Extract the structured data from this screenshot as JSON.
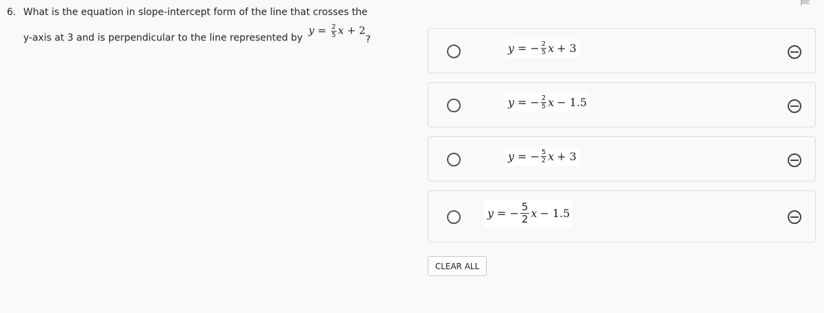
{
  "question": {
    "number": "6.",
    "line1": "What is the equation in slope-intercept form of the line that crosses the",
    "line2": "y-axis at 3 and is perpendicular to the line represented by",
    "inline_equation": {
      "lhs": "y",
      "eq": "=",
      "frac_num": "2",
      "frac_den": "5",
      "var": "x",
      "rest": "+ 2"
    },
    "qmark": "?"
  },
  "choices": [
    {
      "lhs": "y",
      "eq": "=",
      "sign": "−",
      "frac_num": "2",
      "frac_den": "5",
      "var": "x",
      "rest": "+ 3"
    },
    {
      "lhs": "y",
      "eq": "=",
      "sign": "−",
      "frac_num": "2",
      "frac_den": "5",
      "var": "x",
      "rest": "− 1.5"
    },
    {
      "lhs": "y",
      "eq": "=",
      "sign": "−",
      "frac_num": "5",
      "frac_den": "2",
      "var": "x",
      "rest": "+ 3"
    },
    {
      "lhs": "y",
      "eq": "=",
      "sign": "−",
      "frac_num": "5",
      "frac_den": "2",
      "var": "x",
      "rest": "− 1.5"
    }
  ],
  "clear_all_label": "CLEAR ALL",
  "icons": {
    "flag": "flag-icon",
    "strike": "strike-through-icon",
    "radio": "radio-button"
  }
}
